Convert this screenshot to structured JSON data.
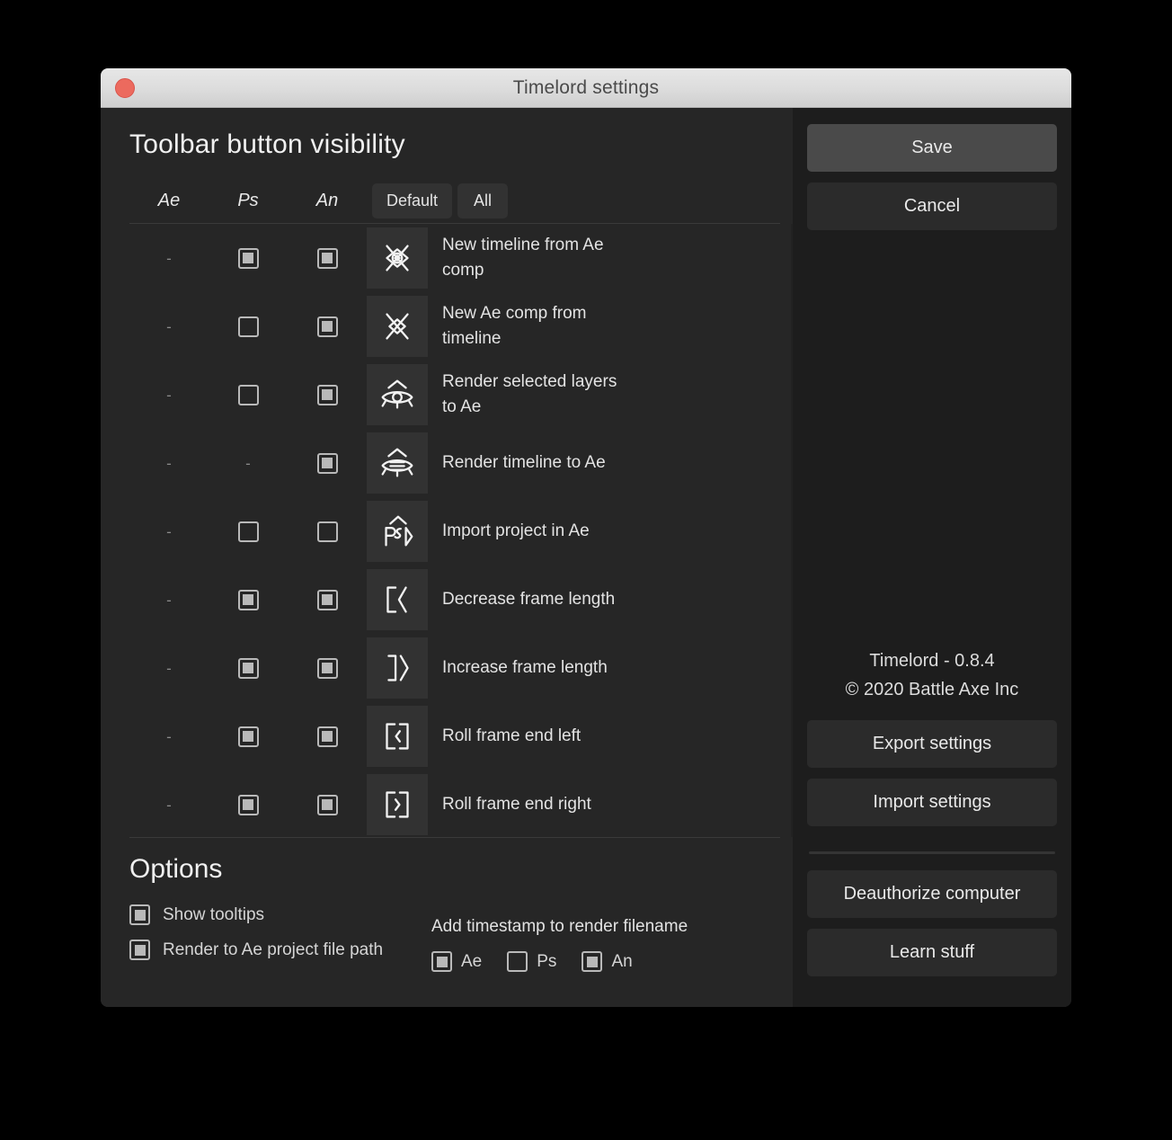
{
  "window": {
    "title": "Timelord settings",
    "close_icon": "close-circle-icon"
  },
  "left": {
    "section_title": "Toolbar button visibility",
    "columns": [
      "Ae",
      "Ps",
      "An"
    ],
    "header_buttons": [
      {
        "label": "Default",
        "name": "default-button"
      },
      {
        "label": "All",
        "name": "all-button"
      }
    ],
    "rows": [
      {
        "label": "New timeline from Ae comp",
        "icon": "new-timeline-from-comp-icon",
        "ae": "dash",
        "ps": "checked",
        "an": "checked"
      },
      {
        "label": "New Ae comp from timeline",
        "icon": "new-comp-from-timeline-icon",
        "ae": "dash",
        "ps": "unchecked",
        "an": "checked"
      },
      {
        "label": "Render selected layers to Ae",
        "icon": "render-selected-layers-icon",
        "ae": "dash",
        "ps": "unchecked",
        "an": "checked"
      },
      {
        "label": "Render timeline to Ae",
        "icon": "render-timeline-icon",
        "ae": "dash",
        "ps": "dash",
        "an": "checked"
      },
      {
        "label": "Import project in Ae",
        "icon": "import-project-icon",
        "ae": "dash",
        "ps": "unchecked",
        "an": "unchecked"
      },
      {
        "label": "Decrease frame length",
        "icon": "decrease-frame-length-icon",
        "ae": "dash",
        "ps": "checked",
        "an": "checked"
      },
      {
        "label": "Increase frame length",
        "icon": "increase-frame-length-icon",
        "ae": "dash",
        "ps": "checked",
        "an": "checked"
      },
      {
        "label": "Roll frame end left",
        "icon": "roll-frame-end-left-icon",
        "ae": "dash",
        "ps": "checked",
        "an": "checked"
      },
      {
        "label": "Roll frame end right",
        "icon": "roll-frame-end-right-icon",
        "ae": "dash",
        "ps": "checked",
        "an": "checked"
      }
    ]
  },
  "options": {
    "title": "Options",
    "toggles": [
      {
        "label": "Show tooltips",
        "state": "checked"
      },
      {
        "label": "Render to Ae project file path",
        "state": "checked"
      }
    ],
    "timestamp": {
      "title": "Add timestamp to render filename",
      "items": [
        {
          "label": "Ae",
          "state": "checked"
        },
        {
          "label": "Ps",
          "state": "unchecked"
        },
        {
          "label": "An",
          "state": "checked"
        }
      ]
    }
  },
  "right": {
    "save_label": "Save",
    "cancel_label": "Cancel",
    "version": "Timelord - 0.8.4",
    "copyright": "© 2020 Battle Axe Inc",
    "export_label": "Export settings",
    "import_label": "Import settings",
    "deauthorize_label": "Deauthorize computer",
    "learn_label": "Learn stuff"
  },
  "colors": {
    "window_bg": "#262626",
    "right_panel_bg": "#1d1d1d",
    "icon_tile": "#323232",
    "accent_close": "#ec6a5e",
    "primary_button": "#4a4a4a",
    "text": "#e3e3e3"
  }
}
